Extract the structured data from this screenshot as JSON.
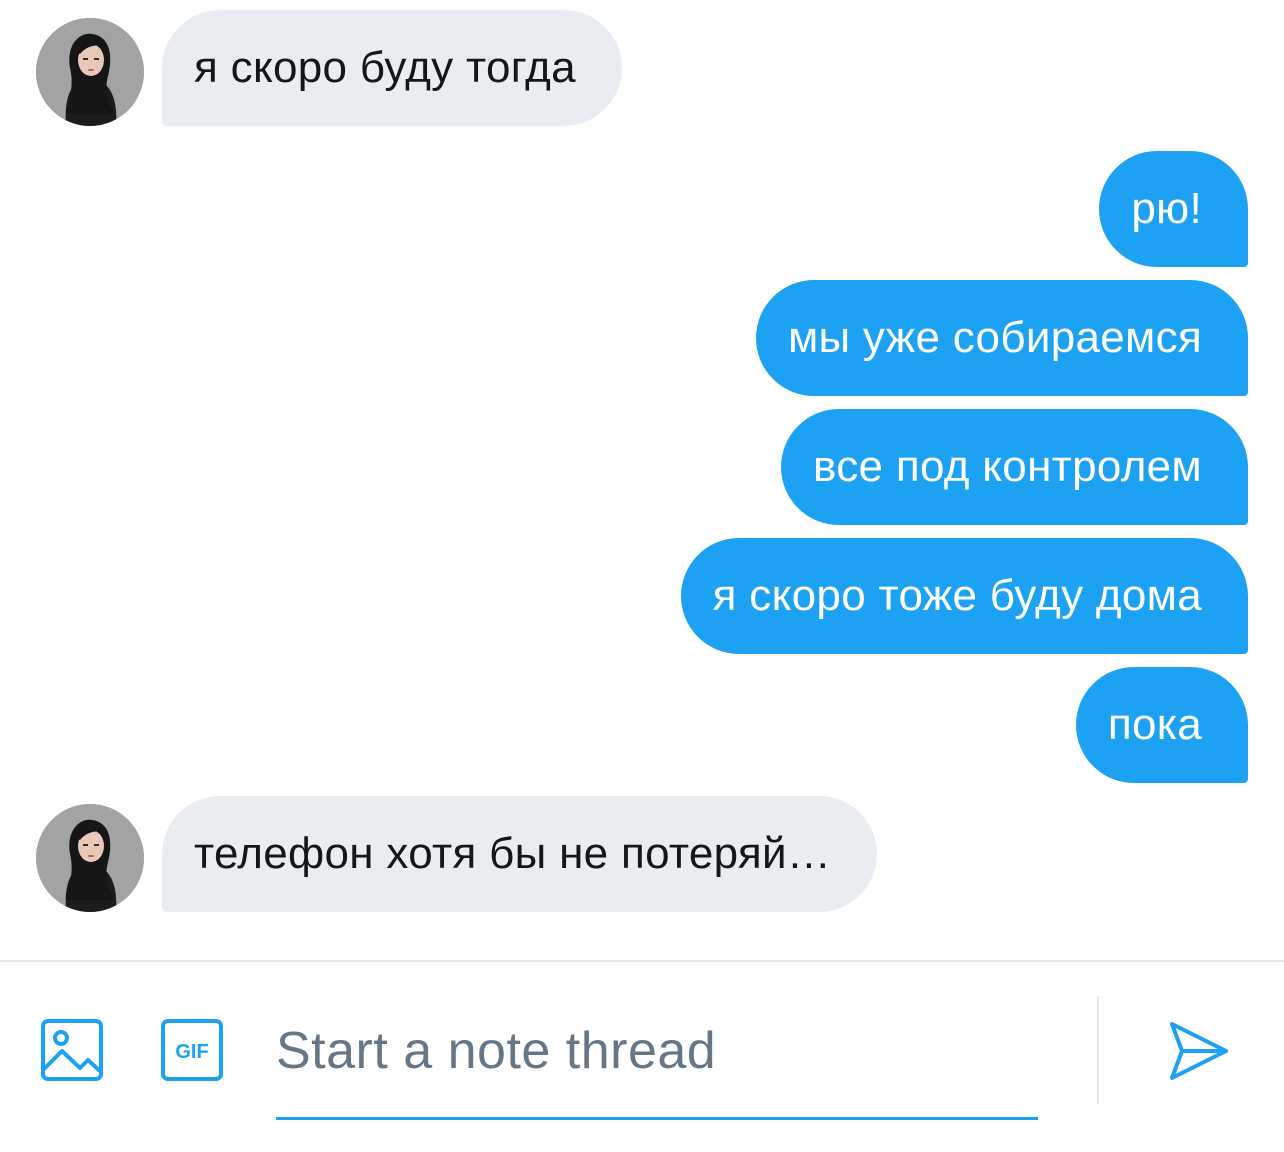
{
  "messages": [
    {
      "side": "in",
      "text": "я скоро буду тогда",
      "avatar": true
    },
    {
      "side": "out",
      "text": "рю!"
    },
    {
      "side": "out",
      "text": "мы уже собираемся"
    },
    {
      "side": "out",
      "text": "все под контролем"
    },
    {
      "side": "out",
      "text": "я скоро тоже буду дома"
    },
    {
      "side": "out",
      "text": "пока"
    },
    {
      "side": "in",
      "text": "телефон хотя бы не потеряй…",
      "avatar": true
    }
  ],
  "composer": {
    "placeholder": "Start a note thread",
    "media_icon": "image-icon",
    "gif_icon": "gif-icon",
    "gif_label": "GIF",
    "send_icon": "send-icon"
  },
  "colors": {
    "accent": "#1da1f2",
    "incoming_bubble": "#e9edf2",
    "placeholder": "#657786"
  }
}
